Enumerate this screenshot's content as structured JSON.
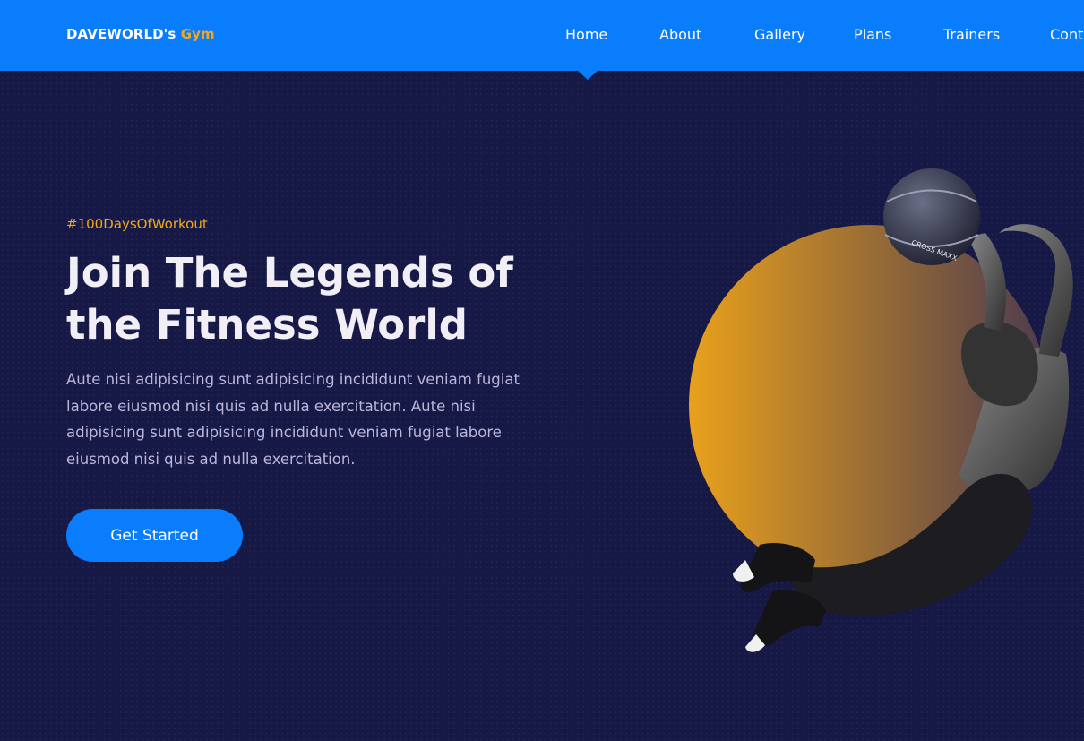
{
  "brand": {
    "name": "DAVEWORLD's",
    "accent": "Gym"
  },
  "nav": {
    "items": [
      {
        "label": "Home"
      },
      {
        "label": "About"
      },
      {
        "label": "Gallery"
      },
      {
        "label": "Plans"
      },
      {
        "label": "Trainers"
      },
      {
        "label": "Contact"
      }
    ],
    "active": "Home"
  },
  "hero": {
    "tag": "#100DaysOfWorkout",
    "title": "Join The Legends of the Fitness World",
    "text": "Aute nisi adipisicing sunt adipisicing incididunt veniam fugiat labore eiusmod nisi quis ad nulla exercitation. Aute nisi adipisicing sunt adipisicing incididunt veniam fugiat labore eiusmod nisi quis ad nulla exercitation.",
    "cta_label": "Get Started",
    "ball_label": "CROSS MAXX"
  },
  "colors": {
    "nav_bg": "#0a7dfc",
    "page_bg": "#161845",
    "accent": "#f2a81e",
    "button": "#0a7dfc"
  },
  "icons": {
    "hero_image": "athlete-with-medicine-ball"
  }
}
